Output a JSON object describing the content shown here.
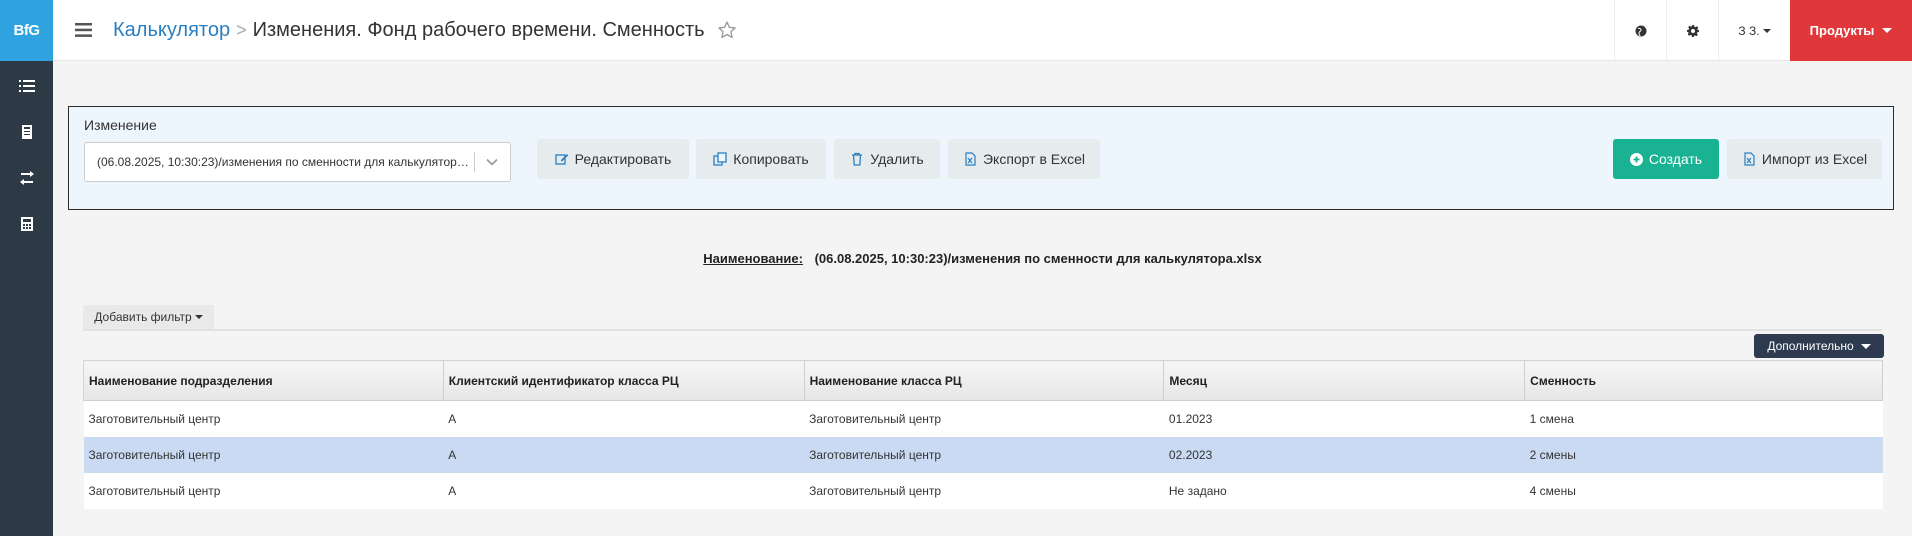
{
  "app": {
    "logo": "BfG"
  },
  "header": {
    "breadcrumb_link": "Калькулятор",
    "breadcrumb_sep": ">",
    "title": "Изменения. Фонд рабочего времени. Сменность",
    "user": "З З.",
    "products_label": "Продукты"
  },
  "toolbar": {
    "change_label": "Изменение",
    "change_value": "(06.08.2025, 10:30:23)/изменения по сменности для калькулятора.xlsx",
    "edit_label": "Редактировать",
    "copy_label": "Копировать",
    "delete_label": "Удалить",
    "export_label": "Экспорт в Excel",
    "create_label": "Создать",
    "import_label": "Импорт из Excel"
  },
  "name_line": {
    "label": "Наименование:",
    "value": "(06.08.2025, 10:30:23)/изменения по сменности для калькулятора.xlsx"
  },
  "filter": {
    "add_label": "Добавить фильтр"
  },
  "more_label": "Дополнительно",
  "table": {
    "columns": [
      "Наименование подразделения",
      "Клиентский идентификатор класса РЦ",
      "Наименование класса РЦ",
      "Месяц",
      "Сменность"
    ],
    "rows": [
      [
        "Заготовительный центр",
        "А",
        "Заготовительный центр",
        "01.2023",
        "1 смена"
      ],
      [
        "Заготовительный центр",
        "А",
        "Заготовительный центр",
        "02.2023",
        "2 смены"
      ],
      [
        "Заготовительный центр",
        "А",
        "Заготовительный центр",
        "Не задано",
        "4 смены"
      ]
    ],
    "selected_row": 1
  },
  "colors": {
    "sidebar": "#2d3a45",
    "logo_bg": "#2ea3e0",
    "products": "#e0383a",
    "create": "#19b394",
    "selected_row": "#c9daf2",
    "more_button": "#2d3a4f"
  }
}
